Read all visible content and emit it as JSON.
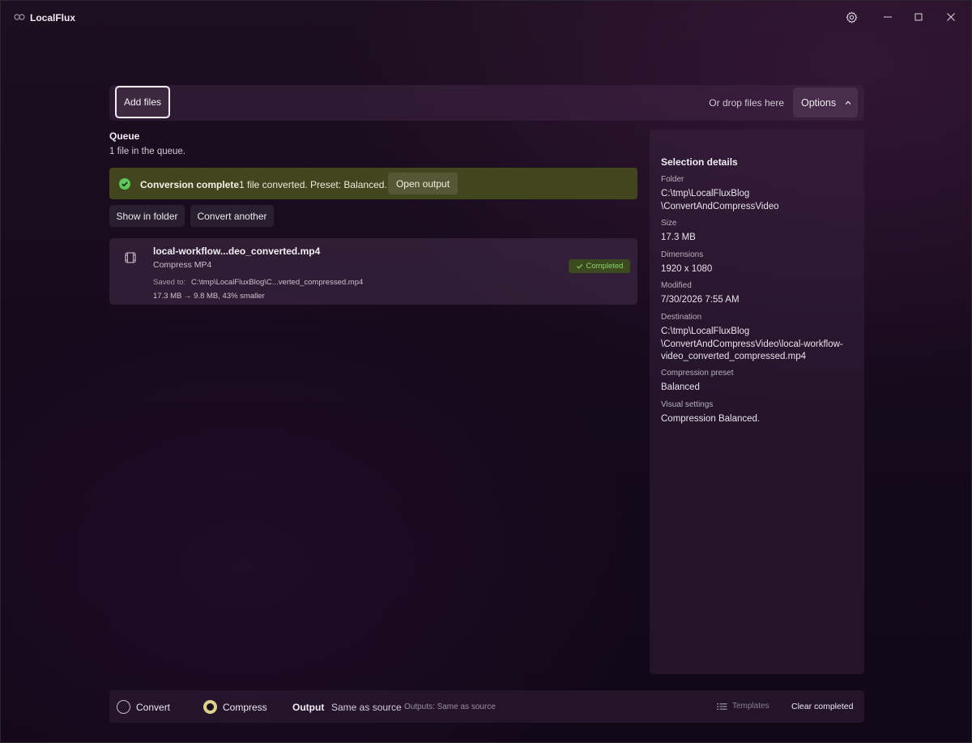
{
  "app": {
    "title": "LocalFlux"
  },
  "toolbar": {
    "add_files": "Add files",
    "drop_hint": "Or drop files here",
    "options": "Options"
  },
  "queue": {
    "title": "Queue",
    "count_text": "1 file in the queue."
  },
  "banner": {
    "title": "Conversion complete",
    "message": "1 file converted. Preset: Balanced.",
    "open_output": "Open output",
    "status_color": "#5ec75a"
  },
  "actions": {
    "show_in_folder": "Show in folder",
    "convert_another": "Convert another"
  },
  "file": {
    "name": "local-workflow...deo_converted.mp4",
    "operation": "Compress MP4",
    "saved_label": "Saved to:",
    "saved_path": "C:\\tmp\\LocalFluxBlog\\C...verted_compressed.mp4",
    "size_info": "17.3 MB → 9.8 MB, 43% smaller",
    "status": "Completed",
    "status_icon": "check-icon"
  },
  "details": {
    "title": "Selection details",
    "folder_label": "Folder",
    "folder_value_1": "C:\\tmp\\LocalFluxBlog",
    "folder_value_2": "\\ConvertAndCompressVideo",
    "size_label": "Size",
    "size_value": "17.3 MB",
    "dimensions_label": "Dimensions",
    "dimensions_value": "1920 x 1080",
    "modified_label": "Modified",
    "modified_value": "7/30/2026 7:55 AM",
    "destination_label": "Destination",
    "destination_value_1": "C:\\tmp\\LocalFluxBlog",
    "destination_value_2": "\\ConvertAndCompressVideo\\local-workflow-",
    "destination_value_3": "video_converted_compressed.mp4",
    "preset_label": "Compression preset",
    "preset_value": "Balanced",
    "visual_label": "Visual settings",
    "visual_value": "Compression Balanced."
  },
  "bottom": {
    "convert": "Convert",
    "compress": "Compress",
    "mode_selected": "Compress",
    "output_label": "Output",
    "output_value": "Same as source",
    "outputs_info": "Outputs: Same as source",
    "templates": "Templates",
    "clear_completed": "Clear completed"
  },
  "colors": {
    "accent_radio": "#dcd191",
    "banner_bg": "#41461f",
    "completed_text": "#8ad36b"
  }
}
